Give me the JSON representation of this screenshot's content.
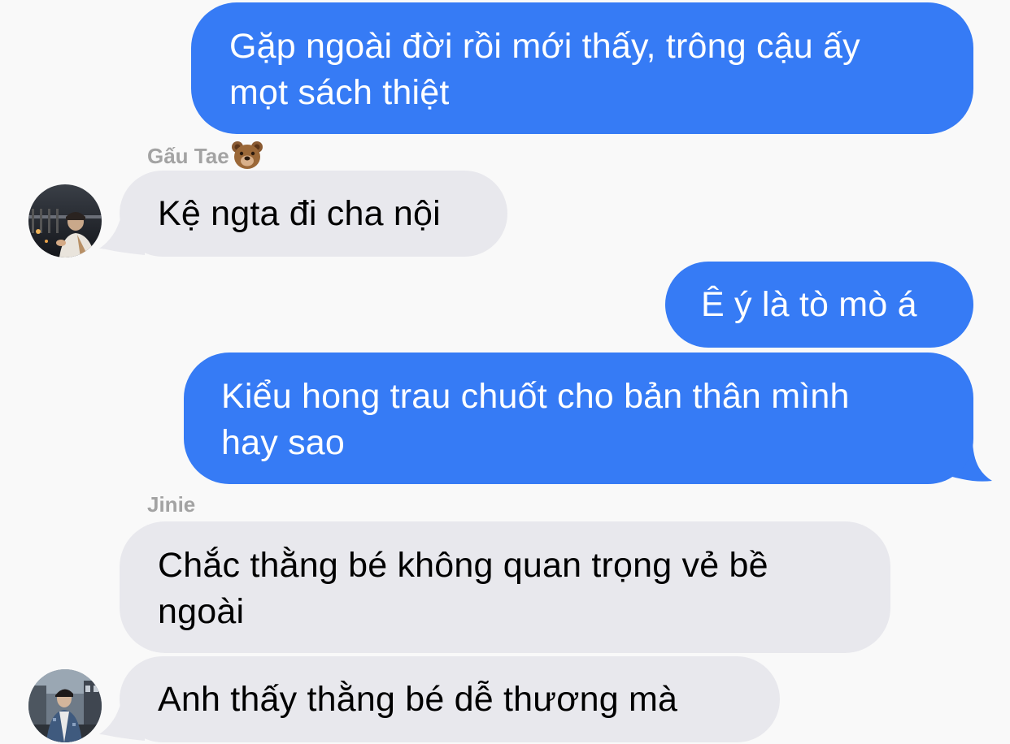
{
  "colors": {
    "background": "#f9f9f9",
    "outgoing_bubble": "#367bf5",
    "incoming_bubble": "#e8e8ed",
    "sender_name": "#a3a3a3"
  },
  "messages": [
    {
      "direction": "outgoing",
      "text": "Gặp ngoài đời rồi mới thấy, trông cậu ấy\nmọt sách thiệt"
    },
    {
      "direction": "incoming",
      "sender": "Gấu Tae",
      "sender_emoji": "bear-face-icon",
      "text": "Kệ ngta đi cha nội"
    },
    {
      "direction": "outgoing",
      "text": "Ê ý là tò mò á"
    },
    {
      "direction": "outgoing",
      "text": "Kiểu hong trau chuốt cho bản thân mình\nhay sao"
    },
    {
      "direction": "incoming",
      "sender": "Jinie",
      "text": "Chắc thằng bé không quan trọng vẻ bề\nngoài"
    },
    {
      "direction": "incoming",
      "text": "Anh thấy thằng bé dễ thương mà"
    }
  ]
}
